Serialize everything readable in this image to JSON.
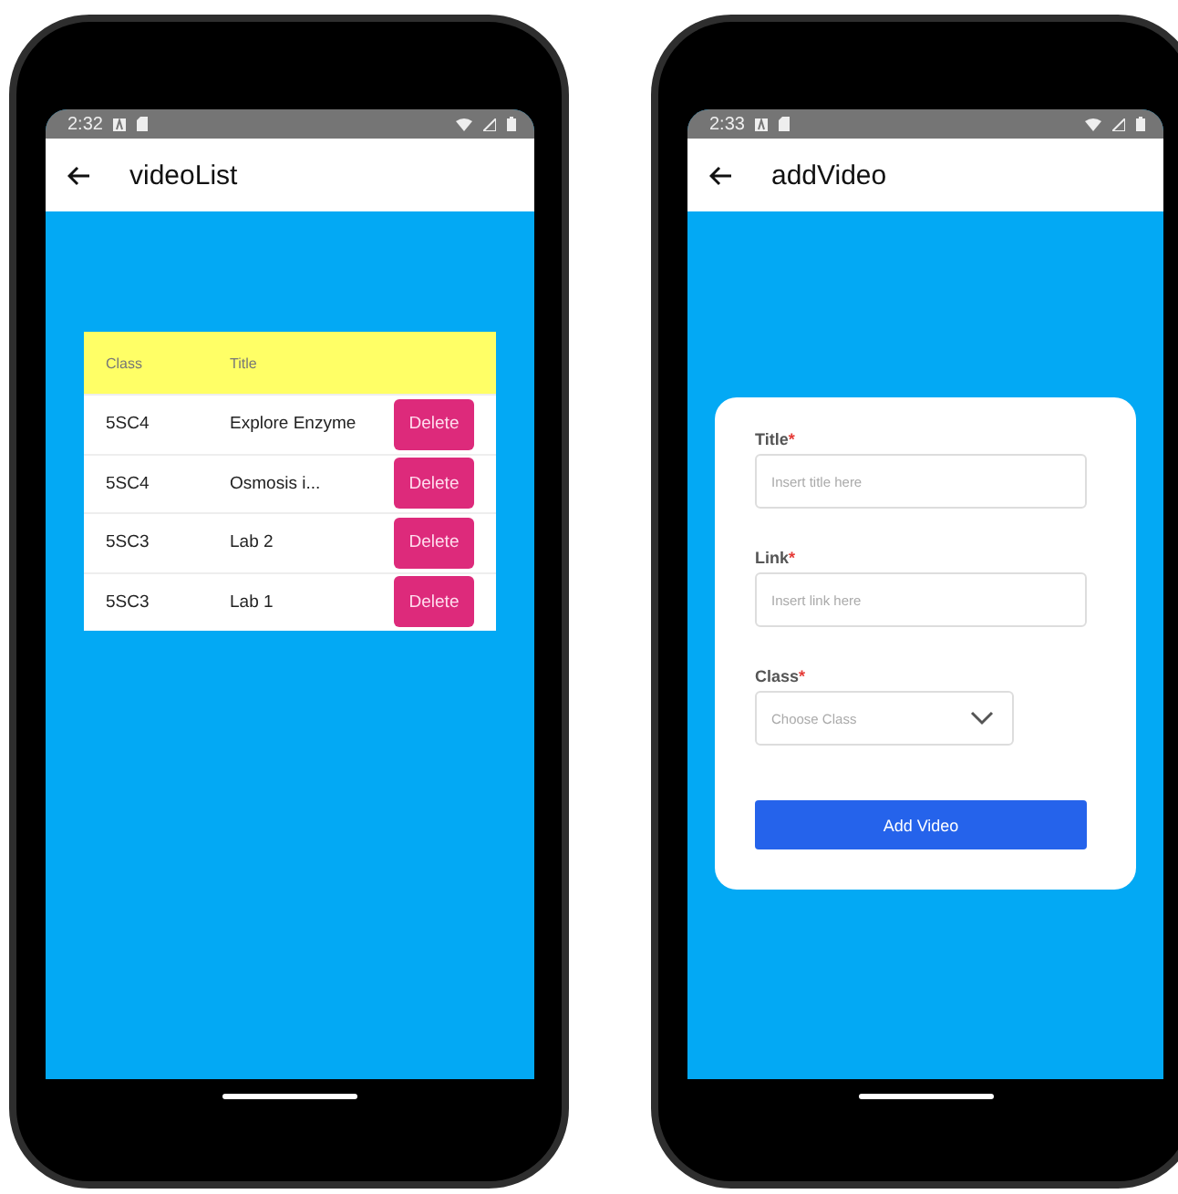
{
  "phones": [
    {
      "kind": "list",
      "status_bar": {
        "time": "2:32"
      },
      "app_bar": {
        "title": "videoList"
      },
      "table": {
        "columns": [
          "Class",
          "Title"
        ],
        "rows": [
          {
            "class": "5SC4",
            "title": "Explore Enzyme",
            "action": "Delete"
          },
          {
            "class": "5SC4",
            "title": "Osmosis i...",
            "action": "Delete"
          },
          {
            "class": "5SC3",
            "title": "Lab 2",
            "action": "Delete"
          },
          {
            "class": "5SC3",
            "title": "Lab 1",
            "action": "Delete"
          }
        ]
      }
    },
    {
      "kind": "form",
      "status_bar": {
        "time": "2:33"
      },
      "app_bar": {
        "title": "addVideo"
      },
      "form": {
        "fields": [
          {
            "kind": "text",
            "label": "Title",
            "required_mark": "*",
            "placeholder": "Insert title here"
          },
          {
            "kind": "text",
            "label": "Link",
            "required_mark": "*",
            "placeholder": "Insert link here"
          },
          {
            "kind": "select",
            "label": "Class",
            "required_mark": "*",
            "placeholder": "Choose Class"
          }
        ],
        "submit": "Add Video"
      }
    }
  ]
}
